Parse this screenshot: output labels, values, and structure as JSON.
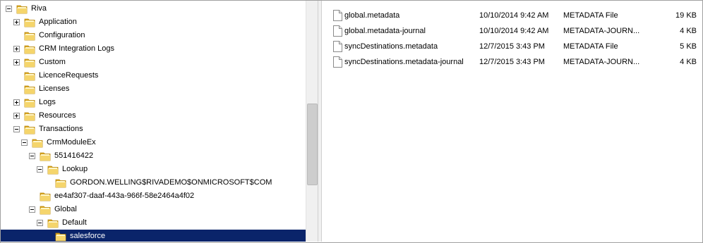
{
  "tree": {
    "items": [
      {
        "label": "Riva",
        "expander": "minus"
      },
      {
        "label": "Application",
        "expander": "plus"
      },
      {
        "label": "Configuration",
        "expander": "none"
      },
      {
        "label": "CRM Integration Logs",
        "expander": "plus"
      },
      {
        "label": "Custom",
        "expander": "plus"
      },
      {
        "label": "LicenceRequests",
        "expander": "none"
      },
      {
        "label": "Licenses",
        "expander": "none"
      },
      {
        "label": "Logs",
        "expander": "plus"
      },
      {
        "label": "Resources",
        "expander": "plus"
      },
      {
        "label": "Transactions",
        "expander": "minus"
      },
      {
        "label": "CrmModuleEx",
        "expander": "minus"
      },
      {
        "label": "551416422",
        "expander": "minus"
      },
      {
        "label": "Lookup",
        "expander": "minus"
      },
      {
        "label": "GORDON.WELLING$RIVADEMO$ONMICROSOFT$COM",
        "expander": "none"
      },
      {
        "label": "ee4af307-daaf-443a-966f-58e2464a4f02",
        "expander": "none"
      },
      {
        "label": "Global",
        "expander": "minus"
      },
      {
        "label": "Default",
        "expander": "minus"
      },
      {
        "label": "salesforce",
        "expander": "none",
        "selected": true
      }
    ]
  },
  "files": [
    {
      "name": "global.metadata",
      "date": "10/10/2014 9:42 AM",
      "type": "METADATA File",
      "size": "19 KB"
    },
    {
      "name": "global.metadata-journal",
      "date": "10/10/2014 9:42 AM",
      "type": "METADATA-JOURN...",
      "size": "4 KB"
    },
    {
      "name": "syncDestinations.metadata",
      "date": "12/7/2015 3:43 PM",
      "type": "METADATA File",
      "size": "5 KB"
    },
    {
      "name": "syncDestinations.metadata-journal",
      "date": "12/7/2015 3:43 PM",
      "type": "METADATA-JOURN...",
      "size": "4 KB"
    }
  ],
  "icons": {
    "folder": "folder-icon",
    "file": "document-icon"
  },
  "colors": {
    "selection": "#0a246a",
    "folder": "#e8c15a"
  }
}
